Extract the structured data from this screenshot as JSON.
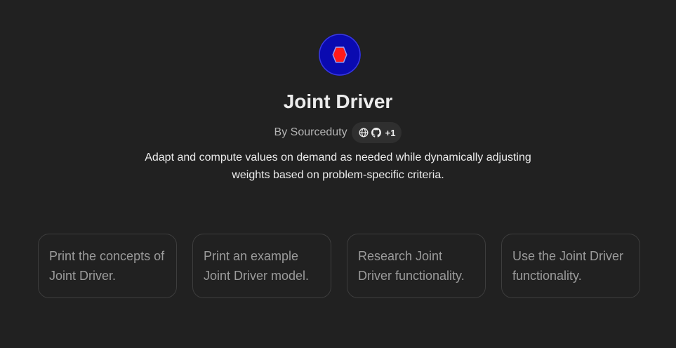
{
  "gpt": {
    "name": "Joint Driver",
    "author": "By Sourceduty",
    "links_extra": "+1",
    "description": "Adapt and compute values on demand as needed while dynamically adjusting weights based on problem-specific criteria.",
    "icons": [
      "globe-icon",
      "github-icon"
    ],
    "logo_colors": {
      "background": "#0a0ab0",
      "shape": "#ff1a1a"
    }
  },
  "starters": [
    {
      "text": "Print the concepts of Joint Driver."
    },
    {
      "text": "Print an example Joint Driver model."
    },
    {
      "text": "Research Joint Driver functionality."
    },
    {
      "text": "Use the Joint Driver functionality."
    }
  ]
}
